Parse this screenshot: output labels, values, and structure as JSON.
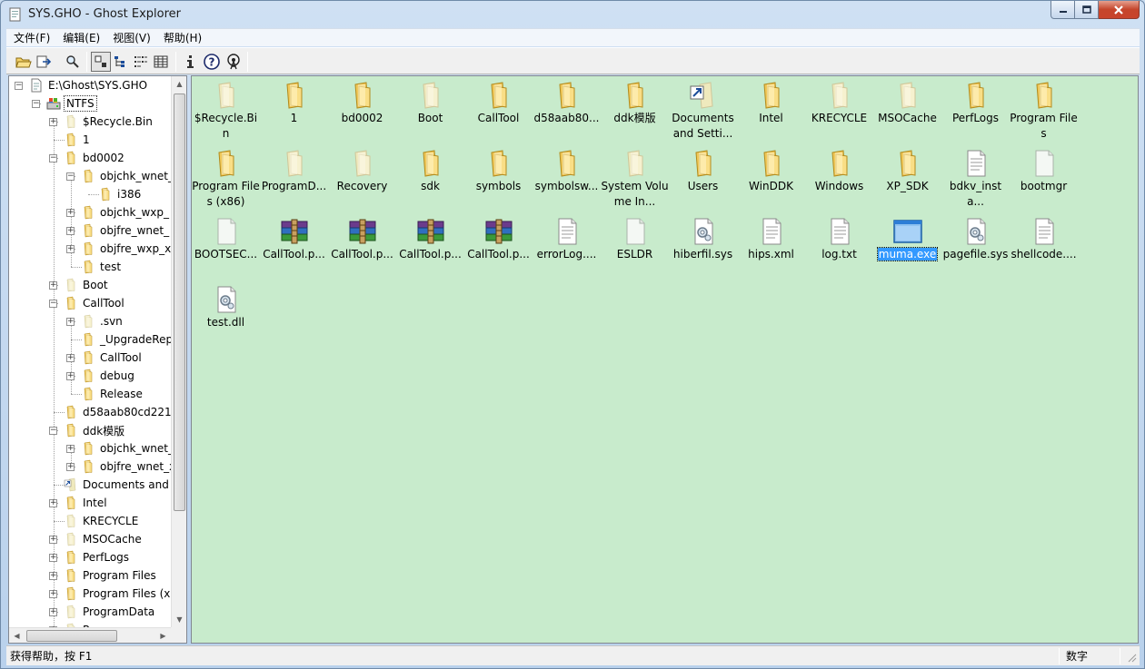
{
  "window": {
    "title": "SYS.GHO - Ghost Explorer"
  },
  "menu": [
    {
      "label": "文件(F)"
    },
    {
      "label": "编辑(E)"
    },
    {
      "label": "视图(V)"
    },
    {
      "label": "帮助(H)"
    }
  ],
  "toolbar": [
    "open-icon",
    "extract-icon",
    "find-icon",
    "large-icons-view-icon",
    "small-icons-view-icon",
    "list-view-icon",
    "details-view-icon",
    "info-icon",
    "help-icon",
    "antenna-icon"
  ],
  "tree": [
    {
      "label": "E:\\Ghost\\SYS.GHO",
      "depth": 0,
      "exp": "-",
      "icon": "file"
    },
    {
      "label": "NTFS",
      "depth": 1,
      "exp": "-",
      "icon": "drive",
      "selected": true
    },
    {
      "label": "$Recycle.Bin",
      "depth": 2,
      "exp": "+",
      "icon": "folder-faded"
    },
    {
      "label": "1",
      "depth": 2,
      "exp": "",
      "icon": "folder"
    },
    {
      "label": "bd0002",
      "depth": 2,
      "exp": "-",
      "icon": "folder"
    },
    {
      "label": "objchk_wnet_",
      "depth": 3,
      "exp": "-",
      "icon": "folder"
    },
    {
      "label": "i386",
      "depth": 4,
      "exp": "",
      "icon": "folder"
    },
    {
      "label": "objchk_wxp_",
      "depth": 3,
      "exp": "+",
      "icon": "folder"
    },
    {
      "label": "objfre_wnet_",
      "depth": 3,
      "exp": "+",
      "icon": "folder"
    },
    {
      "label": "objfre_wxp_x",
      "depth": 3,
      "exp": "+",
      "icon": "folder"
    },
    {
      "label": "test",
      "depth": 3,
      "exp": "",
      "icon": "folder"
    },
    {
      "label": "Boot",
      "depth": 2,
      "exp": "+",
      "icon": "folder-faded"
    },
    {
      "label": "CallTool",
      "depth": 2,
      "exp": "-",
      "icon": "folder"
    },
    {
      "label": ".svn",
      "depth": 3,
      "exp": "+",
      "icon": "folder-faded"
    },
    {
      "label": "_UpgradeRep",
      "depth": 3,
      "exp": "",
      "icon": "folder"
    },
    {
      "label": "CallTool",
      "depth": 3,
      "exp": "+",
      "icon": "folder"
    },
    {
      "label": "debug",
      "depth": 3,
      "exp": "+",
      "icon": "folder"
    },
    {
      "label": "Release",
      "depth": 3,
      "exp": "",
      "icon": "folder"
    },
    {
      "label": "d58aab80cd221",
      "depth": 2,
      "exp": "",
      "icon": "folder"
    },
    {
      "label": "ddk模版",
      "depth": 2,
      "exp": "-",
      "icon": "folder"
    },
    {
      "label": "objchk_wnet_",
      "depth": 3,
      "exp": "+",
      "icon": "folder"
    },
    {
      "label": "objfre_wnet_x",
      "depth": 3,
      "exp": "+",
      "icon": "folder"
    },
    {
      "label": "Documents and",
      "depth": 2,
      "exp": "",
      "icon": "shortcut"
    },
    {
      "label": "Intel",
      "depth": 2,
      "exp": "+",
      "icon": "folder"
    },
    {
      "label": "KRECYCLE",
      "depth": 2,
      "exp": "",
      "icon": "folder-faded"
    },
    {
      "label": "MSOCache",
      "depth": 2,
      "exp": "+",
      "icon": "folder-faded"
    },
    {
      "label": "PerfLogs",
      "depth": 2,
      "exp": "+",
      "icon": "folder"
    },
    {
      "label": "Program Files",
      "depth": 2,
      "exp": "+",
      "icon": "folder"
    },
    {
      "label": "Program Files (x",
      "depth": 2,
      "exp": "+",
      "icon": "folder"
    },
    {
      "label": "ProgramData",
      "depth": 2,
      "exp": "+",
      "icon": "folder-faded"
    },
    {
      "label": "Recovery",
      "depth": 2,
      "exp": "+",
      "icon": "folder-faded"
    }
  ],
  "items": [
    {
      "label": "$Recycle.Bin",
      "icon": "folder-faded"
    },
    {
      "label": "1",
      "icon": "folder"
    },
    {
      "label": "bd0002",
      "icon": "folder"
    },
    {
      "label": "Boot",
      "icon": "folder-faded"
    },
    {
      "label": "CallTool",
      "icon": "folder"
    },
    {
      "label": "d58aab80...",
      "icon": "folder"
    },
    {
      "label": "ddk模版",
      "icon": "folder"
    },
    {
      "label": "Documents and Setti...",
      "icon": "shortcut"
    },
    {
      "label": "Intel",
      "icon": "folder"
    },
    {
      "label": "KRECYCLE",
      "icon": "folder-faded"
    },
    {
      "label": "MSOCache",
      "icon": "folder-faded"
    },
    {
      "label": "PerfLogs",
      "icon": "folder"
    },
    {
      "label": "Program Files",
      "icon": "folder"
    },
    {
      "label": "Program Files (x86)",
      "icon": "folder"
    },
    {
      "label": "ProgramD...",
      "icon": "folder-faded"
    },
    {
      "label": "Recovery",
      "icon": "folder-faded"
    },
    {
      "label": "sdk",
      "icon": "folder"
    },
    {
      "label": "symbols",
      "icon": "folder"
    },
    {
      "label": "symbolsw...",
      "icon": "folder"
    },
    {
      "label": "System Volume In...",
      "icon": "folder-faded"
    },
    {
      "label": "Users",
      "icon": "folder"
    },
    {
      "label": "WinDDK",
      "icon": "folder"
    },
    {
      "label": "Windows",
      "icon": "folder"
    },
    {
      "label": "XP_SDK",
      "icon": "folder"
    },
    {
      "label": "bdkv_insta...",
      "icon": "doc"
    },
    {
      "label": "bootmgr",
      "icon": "blank"
    },
    {
      "label": "BOOTSEC...",
      "icon": "blank"
    },
    {
      "label": "CallTool.p...",
      "icon": "archive"
    },
    {
      "label": "CallTool.p...",
      "icon": "archive"
    },
    {
      "label": "CallTool.p...",
      "icon": "archive"
    },
    {
      "label": "CallTool.p...",
      "icon": "archive"
    },
    {
      "label": "errorLog....",
      "icon": "doc"
    },
    {
      "label": "ESLDR",
      "icon": "blank"
    },
    {
      "label": "hiberfil.sys",
      "icon": "sys"
    },
    {
      "label": "hips.xml",
      "icon": "doc"
    },
    {
      "label": "log.txt",
      "icon": "doc"
    },
    {
      "label": "muma.exe",
      "icon": "exe",
      "selected": true
    },
    {
      "label": "pagefile.sys",
      "icon": "sys"
    },
    {
      "label": "shellcode....",
      "icon": "doc"
    },
    {
      "label": "test.dll",
      "icon": "sys"
    }
  ],
  "status": {
    "help": "获得帮助，按 F1",
    "mode": "数字"
  }
}
